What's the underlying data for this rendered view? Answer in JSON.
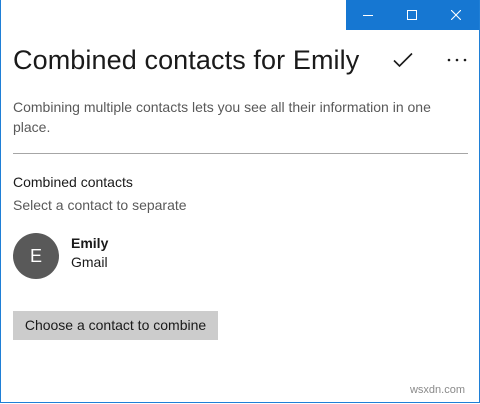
{
  "window": {
    "accent_color": "#1677d2",
    "controls": {
      "minimize_icon": "minimize-icon",
      "maximize_icon": "maximize-icon",
      "close_icon": "close-icon"
    }
  },
  "header": {
    "title": "Combined contacts for Emily",
    "accept_icon": "checkmark-icon",
    "more_icon": "more-icon"
  },
  "description": "Combining multiple contacts lets you see all their information in one place.",
  "section": {
    "heading": "Combined contacts",
    "subheading": "Select a contact to separate"
  },
  "contacts": [
    {
      "initial": "E",
      "name": "Emily",
      "source": "Gmail"
    }
  ],
  "actions": {
    "combine_label": "Choose a contact to combine"
  },
  "watermark": "wsxdn.com"
}
